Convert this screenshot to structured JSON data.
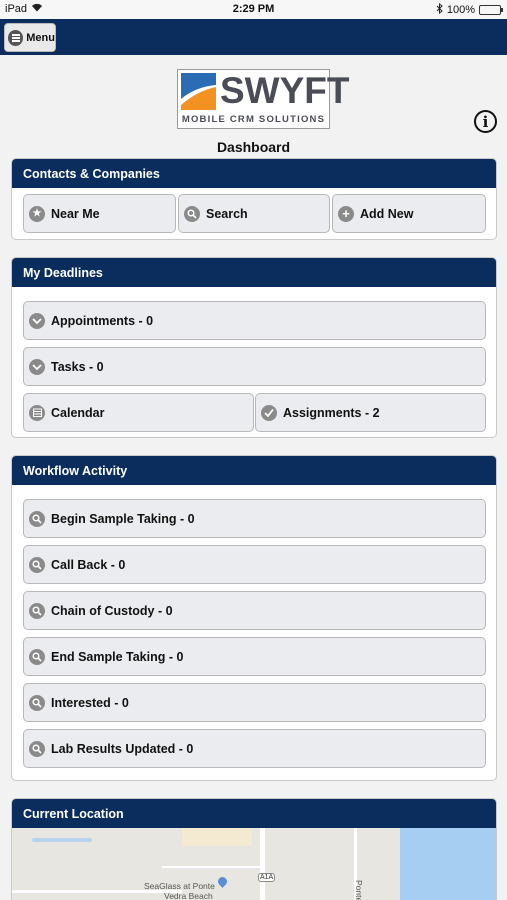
{
  "status_bar": {
    "device": "iPad",
    "time": "2:29 PM",
    "battery": "100%"
  },
  "top_bar": {
    "menu_label": "Menu"
  },
  "logo": {
    "word": "SWYFT",
    "tagline": "MOBILE CRM SOLUTIONS"
  },
  "page_title": "Dashboard",
  "contacts": {
    "title": "Contacts & Companies",
    "buttons": [
      {
        "label": "Near Me",
        "icon": "star-icon"
      },
      {
        "label": "Search",
        "icon": "search-icon"
      },
      {
        "label": "Add New",
        "icon": "plus-icon"
      }
    ]
  },
  "deadlines": {
    "title": "My Deadlines",
    "appointments": "Appointments - 0",
    "tasks": "Tasks - 0",
    "calendar": "Calendar",
    "assignments": "Assignments - 2"
  },
  "workflow": {
    "title": "Workflow Activity",
    "items": [
      "Begin Sample Taking - 0",
      "Call Back - 0",
      "Chain of Custody - 0",
      "End Sample Taking - 0",
      "Interested - 0",
      "Lab Results Updated - 0"
    ]
  },
  "location": {
    "title": "Current Location",
    "map_labels": {
      "poi": "SeaGlass at Ponte",
      "poi_line2": "Vedra Beach",
      "route": "A1A",
      "street": "Ponte"
    }
  },
  "colors": {
    "header": "#0b2d5e",
    "logo_orange": "#f29222",
    "logo_blue": "#2a6db4"
  }
}
